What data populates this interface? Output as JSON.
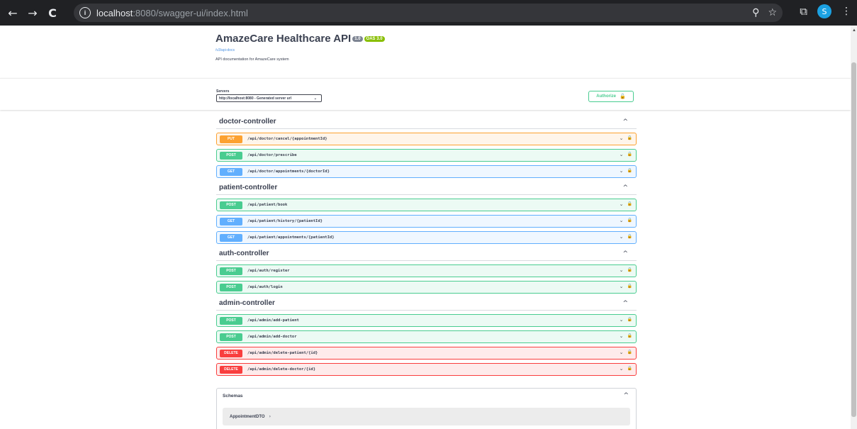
{
  "browser": {
    "back_icon": "←",
    "forward_icon": "→",
    "reload_icon": "C",
    "info_icon": "i",
    "url_host": "localhost",
    "url_rest": ":8080/swagger-ui/index.html",
    "zoom_icon": "⚲",
    "star_icon": "☆",
    "extensions_icon": "⧉",
    "avatar_letter": "S",
    "menu_icon": "⋮"
  },
  "info": {
    "title": "AmazeCare Healthcare API",
    "version_badge": "1.0",
    "oas_badge": "OAS 3.0",
    "spec_link": "/v3/api-docs",
    "description": "API documentation for AmazeCare system"
  },
  "servers": {
    "label": "Servers",
    "selected": "http://localhost:8080 - Generated server url"
  },
  "authorize_label": "Authorize",
  "tags": [
    {
      "name": "doctor-controller",
      "operations": [
        {
          "method": "PUT",
          "path": "/api/doctor/cancel/{appointmentId}"
        },
        {
          "method": "POST",
          "path": "/api/doctor/prescribe"
        },
        {
          "method": "GET",
          "path": "/api/doctor/appointments/{doctorId}"
        }
      ]
    },
    {
      "name": "patient-controller",
      "operations": [
        {
          "method": "POST",
          "path": "/api/patient/book"
        },
        {
          "method": "GET",
          "path": "/api/patient/history/{patientId}"
        },
        {
          "method": "GET",
          "path": "/api/patient/appointments/{patientId}"
        }
      ]
    },
    {
      "name": "auth-controller",
      "operations": [
        {
          "method": "POST",
          "path": "/api/auth/register"
        },
        {
          "method": "POST",
          "path": "/api/auth/login"
        }
      ]
    },
    {
      "name": "admin-controller",
      "operations": [
        {
          "method": "POST",
          "path": "/api/admin/add-patient"
        },
        {
          "method": "POST",
          "path": "/api/admin/add-doctor"
        },
        {
          "method": "DELETE",
          "path": "/api/admin/delete-patient/{id}"
        },
        {
          "method": "DELETE",
          "path": "/api/admin/delete-doctor/{id}"
        }
      ]
    }
  ],
  "schemas": {
    "title": "Schemas",
    "models": [
      "AppointmentDTO"
    ]
  }
}
